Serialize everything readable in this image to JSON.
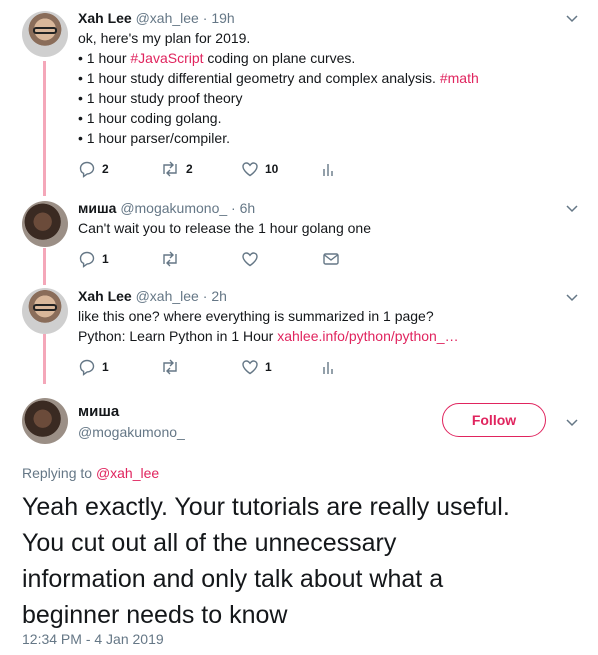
{
  "tweets": [
    {
      "name": "Xah Lee",
      "handle": "@xah_lee",
      "time": "19h",
      "lines": [
        [
          {
            "t": "ok, here's my plan for 2019."
          }
        ],
        [
          {
            "t": "• 1 hour "
          },
          {
            "t": "#JavaScript",
            "link": true
          },
          {
            "t": " coding on plane curves."
          }
        ],
        [
          {
            "t": "• 1 hour study differential geometry and complex analysis. "
          },
          {
            "t": "#math",
            "link": true
          }
        ],
        [
          {
            "t": "• 1 hour study proof theory"
          }
        ],
        [
          {
            "t": "• 1 hour coding golang."
          }
        ],
        [
          {
            "t": "• 1 hour parser/compiler."
          }
        ]
      ],
      "replies": "2",
      "retweets": "2",
      "likes": "10"
    },
    {
      "name": "миша",
      "handle": "@mogakumono_",
      "time": "6h",
      "lines": [
        [
          {
            "t": "Can't wait you to release the 1 hour golang one"
          }
        ]
      ],
      "replies": "1",
      "retweets": "",
      "likes": ""
    },
    {
      "name": "Xah Lee",
      "handle": "@xah_lee",
      "time": "2h",
      "lines": [
        [
          {
            "t": "like this one? where everything is summarized in 1 page?"
          }
        ],
        [
          {
            "t": "Python: Learn Python in 1 Hour "
          },
          {
            "t": "xahlee.info/python/python_…",
            "link": true
          }
        ]
      ],
      "replies": "1",
      "retweets": "",
      "likes": "1"
    }
  ],
  "main_tweet": {
    "name": "миша",
    "handle": "@mogakumono_",
    "follow_label": "Follow",
    "replying_prefix": "Replying to ",
    "replying_to": "@xah_lee",
    "text_lines": [
      "Yeah exactly. Your tutorials are really useful.",
      "You cut out all of the unnecessary",
      "information and only talk about what a",
      "beginner needs to know"
    ],
    "timestamp": "12:34 PM - 4 Jan 2019"
  },
  "separator": " · ",
  "colors": {
    "accent": "#e0245e",
    "thread_line": "#f4a7b9",
    "secondary_text": "#657786"
  }
}
